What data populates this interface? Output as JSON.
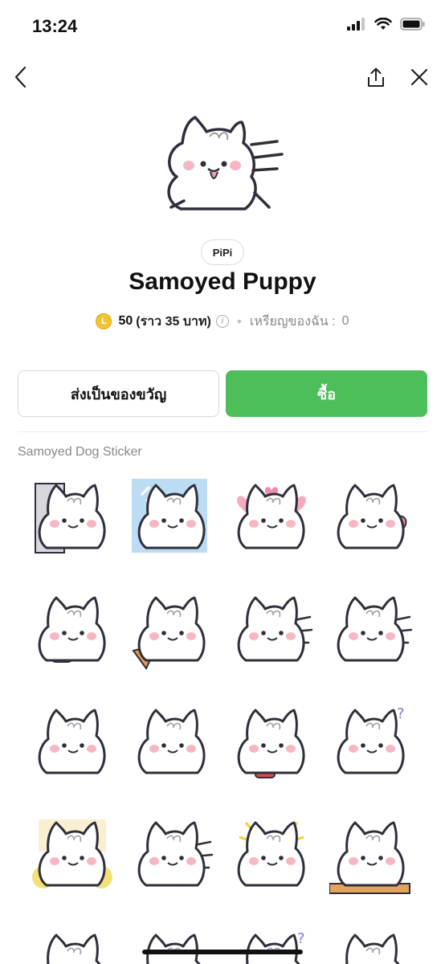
{
  "status_bar": {
    "time": "13:24"
  },
  "nav": {
    "back_icon": "chevron-left-icon",
    "share_icon": "share-icon",
    "close_icon": "close-icon"
  },
  "pack": {
    "author": "PiPi",
    "title": "Samoyed Puppy",
    "price_amount": "50",
    "price_baht": "(ราว 35 บาท)",
    "coin_letter": "L",
    "my_coins_label": "เหรียญของฉัน :",
    "my_coins_value": "0"
  },
  "actions": {
    "gift_label": "ส่งเป็นของขวัญ",
    "buy_label": "ซื้อ"
  },
  "section_label": "Samoyed Dog Sticker",
  "stickers": [
    "sticker-peek-door",
    "sticker-window",
    "sticker-hearts",
    "sticker-heart-throw",
    "sticker-eating-bread",
    "sticker-eating-pizza",
    "sticker-surprised",
    "sticker-running",
    "sticker-spoon-drool",
    "sticker-spoon-cry",
    "sticker-noodles",
    "sticker-confused",
    "sticker-cheer-pompoms",
    "sticker-shiver",
    "sticker-shock",
    "sticker-table",
    "sticker-row5-1",
    "sticker-row5-2",
    "sticker-row5-3",
    "sticker-row5-4"
  ],
  "colors": {
    "buy_green": "#4cbe5a",
    "coin_gold": "#f2c530"
  }
}
